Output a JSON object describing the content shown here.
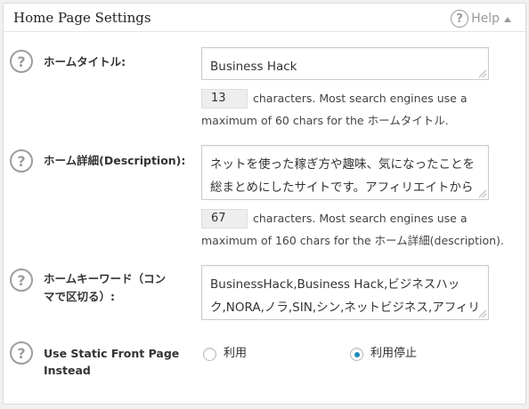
{
  "header": {
    "title": "Home Page Settings",
    "help_label": "Help"
  },
  "home_title": {
    "label": "ホームタイトル:",
    "value": "Business Hack",
    "count": "13",
    "count_text_1": "characters. Most search engines use a",
    "count_text_2": "maximum of 60 chars for the ホームタイトル."
  },
  "home_description": {
    "label": "ホーム詳細(Description):",
    "line1": "ネットを使った稼ぎ方や趣味、気になったことを",
    "line2": "総まとめにしたサイトです。アフィリエイトから",
    "count": "67",
    "count_text_1": "characters. Most search engines use a",
    "count_text_2": "maximum of 160 chars for the ホーム詳細(description)."
  },
  "home_keywords": {
    "label_line1": "ホームキーワード（コン",
    "label_line2": "マで区切る）:",
    "line1": "BusinessHack,Business Hack,ビジネスハッ",
    "line2": "ク,NORA,ノラ,SIN,シン,ネットビジネス,アフィリ"
  },
  "static_front": {
    "label_line1": "Use Static Front Page",
    "label_line2": "Instead",
    "option_use": "利用",
    "option_stop": "利用停止",
    "selected": "利用停止"
  },
  "icons": {
    "help": "question-circle-icon",
    "resize": "resize-grip-icon"
  },
  "colors": {
    "radio_accent": "#1e8cbe",
    "help_gray": "#9d9d9d"
  }
}
